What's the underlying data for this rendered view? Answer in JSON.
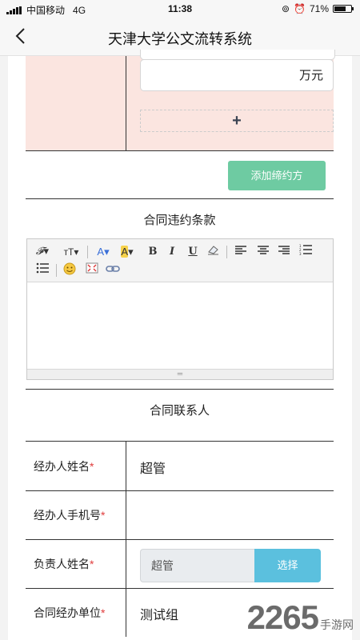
{
  "status_bar": {
    "carrier": "中国移动",
    "network": "4G",
    "time": "11:38",
    "battery": "71%",
    "battery_level": 0.71
  },
  "nav": {
    "back_icon": "chevron-left-icon",
    "title": "天津大学公文流转系统"
  },
  "amount": {
    "unit": "万元"
  },
  "add_box": {
    "symbol": "+"
  },
  "add_party_button": "添加缔约方",
  "breach": {
    "title": "合同违约条款"
  },
  "editor": {
    "toolbar": {
      "font_family": "𝓕",
      "font_size": "тT",
      "font_color": "A",
      "highlight": "A",
      "bold": "B",
      "italic": "I",
      "underline": "U",
      "eraser": "⌫",
      "align_left": "≡",
      "align_center": "≡",
      "align_right": "≡",
      "ordered_list": "⋮≡",
      "unordered_list": "⋮≡",
      "emoji": "☺",
      "fullscreen": "⛶",
      "link": "∞"
    },
    "resize_handle": "═"
  },
  "contacts": {
    "title": "合同联系人",
    "rows": [
      {
        "label": "经办人姓名",
        "required": "*",
        "value": "超管"
      },
      {
        "label": "经办人手机号",
        "required": "*",
        "value": ""
      },
      {
        "label": "负责人姓名",
        "required": "*",
        "input_value": "超管",
        "button": "选择"
      },
      {
        "label": "合同经办单位",
        "required": "*",
        "value": "测试组"
      }
    ]
  },
  "watermark": {
    "number": "2265",
    "text": "手游网"
  },
  "colors": {
    "accent_green": "#6ecba2",
    "select_blue": "#5bc0de",
    "required_red": "#e03c3c",
    "pink_bg": "#fbe5e0"
  }
}
